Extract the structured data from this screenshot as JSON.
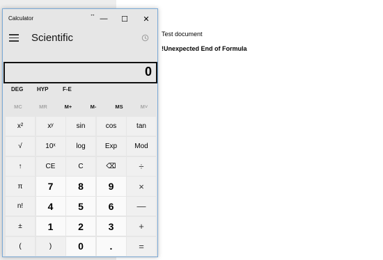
{
  "document": {
    "title": "Test document",
    "error": "!Unexpected End of Formula"
  },
  "calculator": {
    "app_title": "Calculator",
    "restore_glyph": "↔",
    "minimize_glyph": "—",
    "maximize_glyph": "☐",
    "close_glyph": "✕",
    "mode": "Scientific",
    "display_value": "0",
    "angle_row": [
      "DEG",
      "HYP",
      "F-E"
    ],
    "memory_row": [
      {
        "label": "MC",
        "enabled": false
      },
      {
        "label": "MR",
        "enabled": false
      },
      {
        "label": "M+",
        "enabled": true
      },
      {
        "label": "M-",
        "enabled": true
      },
      {
        "label": "MS",
        "enabled": true
      },
      {
        "label": "M˅",
        "enabled": false
      }
    ],
    "keys": [
      {
        "name": "x-squared-button",
        "label": "x²",
        "kind": "fn"
      },
      {
        "name": "x-power-y-button",
        "label": "xʸ",
        "kind": "fn"
      },
      {
        "name": "sin-button",
        "label": "sin",
        "kind": "fn"
      },
      {
        "name": "cos-button",
        "label": "cos",
        "kind": "fn"
      },
      {
        "name": "tan-button",
        "label": "tan",
        "kind": "fn"
      },
      {
        "name": "square-root-button",
        "label": "√",
        "kind": "fn"
      },
      {
        "name": "ten-power-x-button",
        "label": "10ˣ",
        "kind": "fn"
      },
      {
        "name": "log-button",
        "label": "log",
        "kind": "fn"
      },
      {
        "name": "exp-button",
        "label": "Exp",
        "kind": "fn"
      },
      {
        "name": "mod-button",
        "label": "Mod",
        "kind": "fn"
      },
      {
        "name": "shift-button",
        "label": "↑",
        "kind": "fn"
      },
      {
        "name": "clear-entry-button",
        "label": "CE",
        "kind": "fn"
      },
      {
        "name": "clear-button",
        "label": "C",
        "kind": "fn"
      },
      {
        "name": "backspace-button",
        "label": "⌫",
        "kind": "fn"
      },
      {
        "name": "divide-button",
        "label": "÷",
        "kind": "op"
      },
      {
        "name": "pi-button",
        "label": "π",
        "kind": "fn"
      },
      {
        "name": "digit-7-button",
        "label": "7",
        "kind": "num"
      },
      {
        "name": "digit-8-button",
        "label": "8",
        "kind": "num"
      },
      {
        "name": "digit-9-button",
        "label": "9",
        "kind": "num"
      },
      {
        "name": "multiply-button",
        "label": "×",
        "kind": "op"
      },
      {
        "name": "factorial-button",
        "label": "n!",
        "kind": "fn"
      },
      {
        "name": "digit-4-button",
        "label": "4",
        "kind": "num"
      },
      {
        "name": "digit-5-button",
        "label": "5",
        "kind": "num"
      },
      {
        "name": "digit-6-button",
        "label": "6",
        "kind": "num"
      },
      {
        "name": "subtract-button",
        "label": "—",
        "kind": "op"
      },
      {
        "name": "negate-button",
        "label": "±",
        "kind": "fn"
      },
      {
        "name": "digit-1-button",
        "label": "1",
        "kind": "num"
      },
      {
        "name": "digit-2-button",
        "label": "2",
        "kind": "num"
      },
      {
        "name": "digit-3-button",
        "label": "3",
        "kind": "num"
      },
      {
        "name": "add-button",
        "label": "+",
        "kind": "op"
      },
      {
        "name": "open-paren-button",
        "label": "(",
        "kind": "fn"
      },
      {
        "name": "close-paren-button",
        "label": ")",
        "kind": "fn"
      },
      {
        "name": "digit-0-button",
        "label": "0",
        "kind": "num"
      },
      {
        "name": "decimal-button",
        "label": ".",
        "kind": "num"
      },
      {
        "name": "equals-button",
        "label": "=",
        "kind": "op"
      }
    ]
  }
}
